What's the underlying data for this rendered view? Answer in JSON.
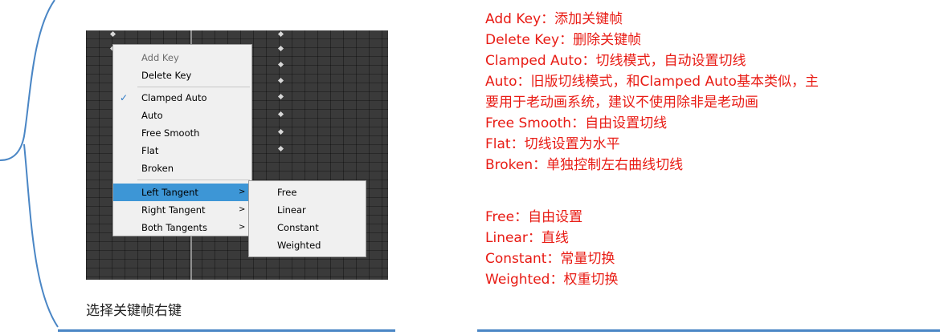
{
  "screenshot": {
    "menu": {
      "items": [
        {
          "label": "Add Key",
          "disabled": true
        },
        {
          "label": "Delete Key"
        },
        {
          "label": "Clamped Auto",
          "checked": true
        },
        {
          "label": "Auto"
        },
        {
          "label": "Free Smooth"
        },
        {
          "label": "Flat"
        },
        {
          "label": "Broken"
        },
        {
          "label": "Left Tangent",
          "submenu": true,
          "highlighted": true
        },
        {
          "label": "Right Tangent",
          "submenu": true
        },
        {
          "label": "Both Tangents",
          "submenu": true
        }
      ],
      "check_glyph": "✓",
      "arrow_glyph": ">"
    },
    "submenu": {
      "items": [
        "Free",
        "Linear",
        "Constant",
        "Weighted"
      ]
    }
  },
  "caption": "选择关键帧右键",
  "notes": [
    "Add Key：添加关键帧",
    "Delete Key：删除关键帧",
    "Clamped Auto：切线模式，自动设置切线",
    "Auto：旧版切线模式，和Clamped Auto基本类似，主",
    "要用于老动画系统，建议不使用除非是老动画",
    "Free Smooth：自由设置切线",
    "Flat：切线设置为水平",
    "Broken：单独控制左右曲线切线",
    "Free：自由设置",
    "Linear：直线",
    "Constant：常量切换",
    "Weighted：权重切换"
  ],
  "colors": {
    "note_text": "#e81b14",
    "connector": "#4a86c5",
    "highlight": "#3d96d6",
    "editor_bg": "#3a3a3a"
  }
}
